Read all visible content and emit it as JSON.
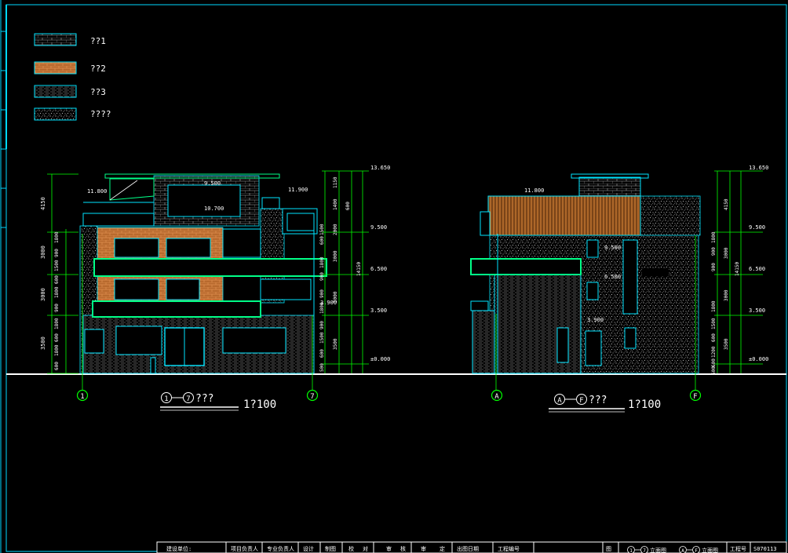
{
  "legend": [
    {
      "label": "??1",
      "pattern": "brick"
    },
    {
      "label": "??2",
      "pattern": "orange-brick"
    },
    {
      "label": "??3",
      "pattern": "horizontal-lines"
    },
    {
      "label": "????",
      "pattern": "stipple"
    }
  ],
  "left_elevation": {
    "axis_start": "1",
    "axis_end": "7",
    "title_suffix": "???",
    "scale": "1?100",
    "level_labels": [
      "11.800",
      "9.500",
      "10.700",
      "11.900",
      "3.900"
    ],
    "right_dims": [
      "13.650",
      "9.500",
      "6.500",
      "3.500",
      "±0.000"
    ],
    "right_segments": [
      "1150",
      "1400",
      "2000",
      "3000",
      "3000",
      "3500",
      "14150"
    ],
    "right_small": [
      "600",
      "1500",
      "600",
      "1800",
      "900",
      "900",
      "1800",
      "900",
      "1500",
      "600",
      "500"
    ],
    "left_dims": [
      "4150",
      "3000",
      "3000",
      "3500"
    ],
    "left_small": [
      "1800",
      "900",
      "1500",
      "600",
      "1800",
      "900",
      "1800",
      "600",
      "1800",
      "600"
    ]
  },
  "right_elevation": {
    "axis_start": "A",
    "axis_end": "F",
    "title_suffix": "???",
    "scale": "1?100",
    "level_labels": [
      "11.800",
      "3.900",
      "6.500",
      "9.500"
    ],
    "right_dims": [
      "13.650",
      "9.500",
      "6.500",
      "3.500",
      "±0.000"
    ],
    "right_segments": [
      "4150",
      "3000",
      "3000",
      "3500",
      "14150"
    ],
    "right_small": [
      "1800",
      "900",
      "900",
      "1800",
      "1500",
      "600",
      "1200",
      "600",
      "600"
    ]
  },
  "title_block": {
    "cells": [
      "建设单位:",
      "项目负责人",
      "专业负责人",
      "设计",
      "制图",
      "校",
      "对",
      "审",
      "核",
      "审",
      "定",
      "出图日期",
      "工程编号",
      "图",
      "立面图",
      "立面图",
      "工程号",
      "S070113"
    ],
    "axis_pairs": [
      [
        "1",
        "7"
      ],
      [
        "A",
        "F"
      ]
    ]
  },
  "colors": {
    "frame": "#00e5ff",
    "dim": "#00ff00",
    "text": "#ffffff",
    "brick": "#c87838",
    "ground": "#ffffff"
  }
}
